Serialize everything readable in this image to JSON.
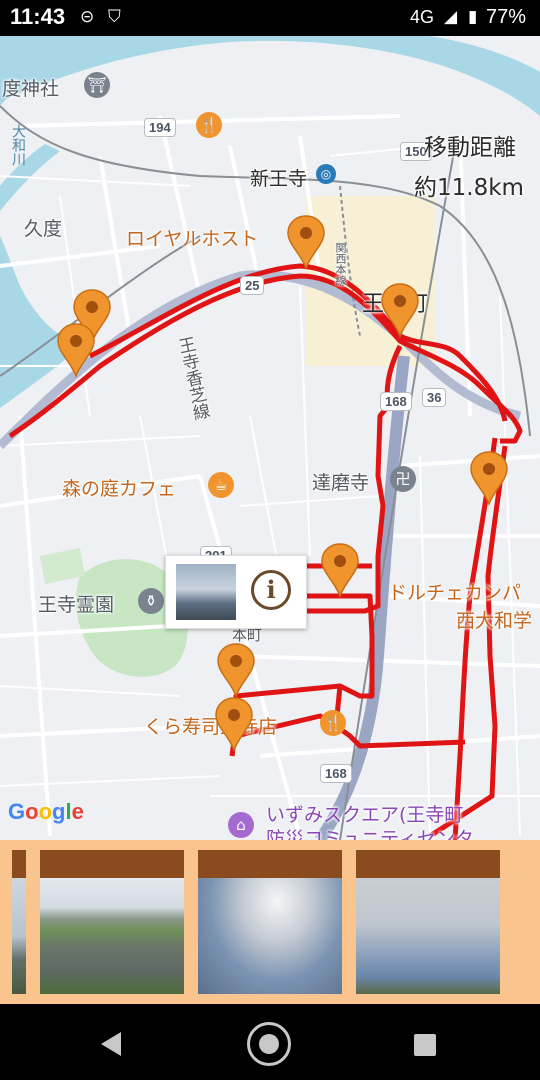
{
  "status_bar": {
    "time": "11:43",
    "network": "4G",
    "battery": "77%"
  },
  "map": {
    "labels": {
      "shrine": "度神社",
      "river": "大和川",
      "kudo": "久度",
      "royal_host": "ロイヤルホスト",
      "shin_oji_station": "新王寺",
      "oji_line": "王寺香芝線",
      "railway_line": "関西本線",
      "ojicho": "王寺町",
      "cafe": "森の庭カフェ",
      "daruma": "達磨寺",
      "cemetery": "王寺霊園",
      "dolce": "ドルチェカンパ",
      "nishi_yamato": "西大和学",
      "kura": "くら寿司王寺店",
      "izumi": "いずみスクエア(王寺町",
      "izumi_sub": "防災コミュニティセンタ",
      "town_small": "本町"
    },
    "route_shields": [
      "194",
      "150",
      "25",
      "168",
      "36",
      "201",
      "168"
    ],
    "distance": {
      "label": "移動距離",
      "value": "約11.8km"
    },
    "google_logo": "Google"
  },
  "colors": {
    "route": "#e01414",
    "pin": "#f0952e",
    "strip": "#f9c48d",
    "caption": "#8a4b1f"
  }
}
